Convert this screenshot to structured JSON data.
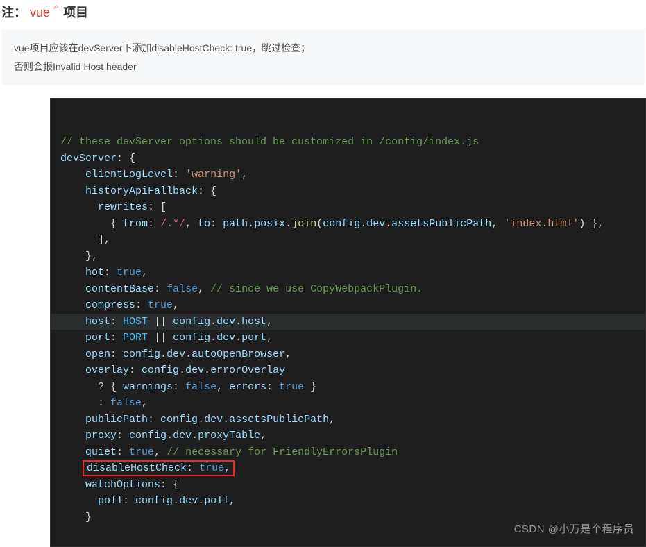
{
  "header": {
    "label": "注：",
    "vue": "vue",
    "suffix": "项目"
  },
  "note": {
    "line1": "vue项目应该在devServer下添加disableHostCheck: true，跳过检查；",
    "line2": "否则会报Invalid Host header"
  },
  "code": {
    "lines": [
      {
        "segs": [
          {
            "cls": "tok-comment",
            "t": "// these devServer options should be customized in /config/index.js"
          }
        ]
      },
      {
        "segs": [
          {
            "cls": "tok-key",
            "t": "devServer"
          },
          {
            "cls": "tok-punct",
            "t": ": {"
          }
        ]
      },
      {
        "indent": "    ",
        "segs": [
          {
            "cls": "tok-key",
            "t": "clientLogLevel"
          },
          {
            "cls": "tok-punct",
            "t": ": "
          },
          {
            "cls": "tok-string",
            "t": "'warning'"
          },
          {
            "cls": "tok-punct",
            "t": ","
          }
        ]
      },
      {
        "indent": "    ",
        "segs": [
          {
            "cls": "tok-key",
            "t": "historyApiFallback"
          },
          {
            "cls": "tok-punct",
            "t": ": {"
          }
        ]
      },
      {
        "indent": "      ",
        "segs": [
          {
            "cls": "tok-key",
            "t": "rewrites"
          },
          {
            "cls": "tok-punct",
            "t": ": ["
          }
        ]
      },
      {
        "indent": "        ",
        "segs": [
          {
            "cls": "tok-punct",
            "t": "{ "
          },
          {
            "cls": "tok-key",
            "t": "from"
          },
          {
            "cls": "tok-punct",
            "t": ": "
          },
          {
            "cls": "tok-regex",
            "t": "/.*/"
          },
          {
            "cls": "tok-punct",
            "t": ", "
          },
          {
            "cls": "tok-key",
            "t": "to"
          },
          {
            "cls": "tok-punct",
            "t": ": "
          },
          {
            "cls": "tok-var",
            "t": "path"
          },
          {
            "cls": "tok-punct",
            "t": "."
          },
          {
            "cls": "tok-var",
            "t": "posix"
          },
          {
            "cls": "tok-punct",
            "t": "."
          },
          {
            "cls": "tok-func",
            "t": "join"
          },
          {
            "cls": "tok-punct",
            "t": "("
          },
          {
            "cls": "tok-var",
            "t": "config"
          },
          {
            "cls": "tok-punct",
            "t": "."
          },
          {
            "cls": "tok-var",
            "t": "dev"
          },
          {
            "cls": "tok-punct",
            "t": "."
          },
          {
            "cls": "tok-var",
            "t": "assetsPublicPath"
          },
          {
            "cls": "tok-punct",
            "t": ", "
          },
          {
            "cls": "tok-string",
            "t": "'index.html'"
          },
          {
            "cls": "tok-punct",
            "t": ") },"
          }
        ]
      },
      {
        "indent": "      ",
        "segs": [
          {
            "cls": "tok-punct",
            "t": "],"
          }
        ]
      },
      {
        "indent": "    ",
        "segs": [
          {
            "cls": "tok-punct",
            "t": "},"
          }
        ]
      },
      {
        "indent": "    ",
        "segs": [
          {
            "cls": "tok-key",
            "t": "hot"
          },
          {
            "cls": "tok-punct",
            "t": ": "
          },
          {
            "cls": "tok-const",
            "t": "true"
          },
          {
            "cls": "tok-punct",
            "t": ","
          }
        ]
      },
      {
        "indent": "    ",
        "segs": [
          {
            "cls": "tok-key",
            "t": "contentBase"
          },
          {
            "cls": "tok-punct",
            "t": ": "
          },
          {
            "cls": "tok-const",
            "t": "false"
          },
          {
            "cls": "tok-punct",
            "t": ", "
          },
          {
            "cls": "tok-comment",
            "t": "// since we use CopyWebpackPlugin."
          }
        ]
      },
      {
        "indent": "    ",
        "segs": [
          {
            "cls": "tok-key",
            "t": "compress"
          },
          {
            "cls": "tok-punct",
            "t": ": "
          },
          {
            "cls": "tok-const",
            "t": "true"
          },
          {
            "cls": "tok-punct",
            "t": ","
          }
        ]
      },
      {
        "indent": "    ",
        "highlight": true,
        "segs": [
          {
            "cls": "tok-key",
            "t": "host"
          },
          {
            "cls": "tok-punct",
            "t": ": "
          },
          {
            "cls": "tok-upper",
            "t": "HOST"
          },
          {
            "cls": "tok-punct",
            "t": " || "
          },
          {
            "cls": "tok-var",
            "t": "config"
          },
          {
            "cls": "tok-punct",
            "t": "."
          },
          {
            "cls": "tok-var",
            "t": "dev"
          },
          {
            "cls": "tok-punct",
            "t": "."
          },
          {
            "cls": "tok-var",
            "t": "host"
          },
          {
            "cls": "tok-punct",
            "t": ","
          }
        ]
      },
      {
        "indent": "    ",
        "segs": [
          {
            "cls": "tok-key",
            "t": "port"
          },
          {
            "cls": "tok-punct",
            "t": ": "
          },
          {
            "cls": "tok-upper",
            "t": "PORT"
          },
          {
            "cls": "tok-punct",
            "t": " || "
          },
          {
            "cls": "tok-var",
            "t": "config"
          },
          {
            "cls": "tok-punct",
            "t": "."
          },
          {
            "cls": "tok-var",
            "t": "dev"
          },
          {
            "cls": "tok-punct",
            "t": "."
          },
          {
            "cls": "tok-var",
            "t": "port"
          },
          {
            "cls": "tok-punct",
            "t": ","
          }
        ]
      },
      {
        "indent": "    ",
        "segs": [
          {
            "cls": "tok-key",
            "t": "open"
          },
          {
            "cls": "tok-punct",
            "t": ": "
          },
          {
            "cls": "tok-var",
            "t": "config"
          },
          {
            "cls": "tok-punct",
            "t": "."
          },
          {
            "cls": "tok-var",
            "t": "dev"
          },
          {
            "cls": "tok-punct",
            "t": "."
          },
          {
            "cls": "tok-var",
            "t": "autoOpenBrowser"
          },
          {
            "cls": "tok-punct",
            "t": ","
          }
        ]
      },
      {
        "indent": "    ",
        "segs": [
          {
            "cls": "tok-key",
            "t": "overlay"
          },
          {
            "cls": "tok-punct",
            "t": ": "
          },
          {
            "cls": "tok-var",
            "t": "config"
          },
          {
            "cls": "tok-punct",
            "t": "."
          },
          {
            "cls": "tok-var",
            "t": "dev"
          },
          {
            "cls": "tok-punct",
            "t": "."
          },
          {
            "cls": "tok-var",
            "t": "errorOverlay"
          }
        ]
      },
      {
        "indent": "      ",
        "segs": [
          {
            "cls": "tok-punct",
            "t": "? { "
          },
          {
            "cls": "tok-key",
            "t": "warnings"
          },
          {
            "cls": "tok-punct",
            "t": ": "
          },
          {
            "cls": "tok-const",
            "t": "false"
          },
          {
            "cls": "tok-punct",
            "t": ", "
          },
          {
            "cls": "tok-key",
            "t": "errors"
          },
          {
            "cls": "tok-punct",
            "t": ": "
          },
          {
            "cls": "tok-const",
            "t": "true"
          },
          {
            "cls": "tok-punct",
            "t": " }"
          }
        ]
      },
      {
        "indent": "      ",
        "segs": [
          {
            "cls": "tok-punct",
            "t": ": "
          },
          {
            "cls": "tok-const",
            "t": "false"
          },
          {
            "cls": "tok-punct",
            "t": ","
          }
        ]
      },
      {
        "indent": "    ",
        "segs": [
          {
            "cls": "tok-key",
            "t": "publicPath"
          },
          {
            "cls": "tok-punct",
            "t": ": "
          },
          {
            "cls": "tok-var",
            "t": "config"
          },
          {
            "cls": "tok-punct",
            "t": "."
          },
          {
            "cls": "tok-var",
            "t": "dev"
          },
          {
            "cls": "tok-punct",
            "t": "."
          },
          {
            "cls": "tok-var",
            "t": "assetsPublicPath"
          },
          {
            "cls": "tok-punct",
            "t": ","
          }
        ]
      },
      {
        "indent": "    ",
        "segs": [
          {
            "cls": "tok-key",
            "t": "proxy"
          },
          {
            "cls": "tok-punct",
            "t": ": "
          },
          {
            "cls": "tok-var",
            "t": "config"
          },
          {
            "cls": "tok-punct",
            "t": "."
          },
          {
            "cls": "tok-var",
            "t": "dev"
          },
          {
            "cls": "tok-punct",
            "t": "."
          },
          {
            "cls": "tok-var",
            "t": "proxyTable"
          },
          {
            "cls": "tok-punct",
            "t": ","
          }
        ]
      },
      {
        "indent": "    ",
        "segs": [
          {
            "cls": "tok-key",
            "t": "quiet"
          },
          {
            "cls": "tok-punct",
            "t": ": "
          },
          {
            "cls": "tok-const",
            "t": "true"
          },
          {
            "cls": "tok-punct",
            "t": ", "
          },
          {
            "cls": "tok-comment",
            "t": "// necessary for FriendlyErrorsPlugin"
          }
        ]
      },
      {
        "indent": "    ",
        "redbox": true,
        "segs": [
          {
            "cls": "tok-key",
            "t": "disableHostCheck"
          },
          {
            "cls": "tok-punct",
            "t": ": "
          },
          {
            "cls": "tok-const",
            "t": "true"
          },
          {
            "cls": "tok-punct",
            "t": ","
          }
        ]
      },
      {
        "indent": "    ",
        "segs": [
          {
            "cls": "tok-key",
            "t": "watchOptions"
          },
          {
            "cls": "tok-punct",
            "t": ": {"
          }
        ]
      },
      {
        "indent": "      ",
        "segs": [
          {
            "cls": "tok-key",
            "t": "poll"
          },
          {
            "cls": "tok-punct",
            "t": ": "
          },
          {
            "cls": "tok-var",
            "t": "config"
          },
          {
            "cls": "tok-punct",
            "t": "."
          },
          {
            "cls": "tok-var",
            "t": "dev"
          },
          {
            "cls": "tok-punct",
            "t": "."
          },
          {
            "cls": "tok-var",
            "t": "poll"
          },
          {
            "cls": "tok-punct",
            "t": ","
          }
        ]
      },
      {
        "indent": "    ",
        "segs": [
          {
            "cls": "tok-punct",
            "t": "}"
          }
        ]
      }
    ]
  },
  "watermark": "CSDN @小万是个程序员"
}
